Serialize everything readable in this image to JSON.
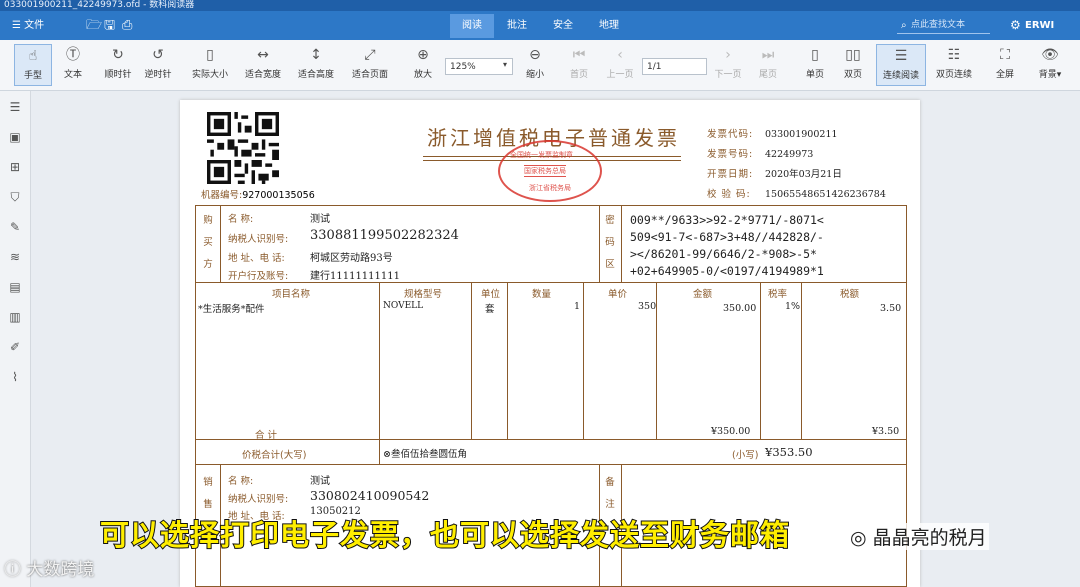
{
  "window": {
    "title": "033001900211_42249973.ofd - 数科阅读器"
  },
  "menubar": {
    "file_label": "☰ 文件",
    "tabs": [
      {
        "label": "阅读"
      },
      {
        "label": "批注"
      },
      {
        "label": "安全"
      },
      {
        "label": "地理"
      }
    ],
    "search_placeholder": "点此查找文本",
    "user_label": "ERWI"
  },
  "toolbar": {
    "tools": [
      "手型",
      "文本",
      "顺时针",
      "逆时针",
      "实际大小",
      "适合宽度",
      "适合高度",
      "适合页面",
      "放大",
      "缩小",
      "首页",
      "上一页",
      "下一页",
      "尾页",
      "单页",
      "双页",
      "连续阅读",
      "双页连续",
      "全屏",
      "背景"
    ],
    "zoom_value": "125%",
    "page_value": "1/1"
  },
  "invoice": {
    "title": "浙江增值税电子普通发票",
    "seal": {
      "line1": "全国统一发票监制章",
      "line2": "国家税务总局",
      "line3": "浙江省税务局"
    },
    "meta": {
      "code_label": "发票代码:",
      "code": "033001900211",
      "number_label": "发票号码:",
      "number": "42249973",
      "date_label": "开票日期:",
      "date": "2020年03月21日",
      "check_label": "校 验 码:",
      "check": "15065548651426236784"
    },
    "machine_label": "机器编号:",
    "machine_no": "927000135056",
    "buyer": {
      "side_label": "购买方",
      "name_label": "名        称:",
      "name": "测试",
      "taxid_label": "纳税人识别号:",
      "taxid": "330881199502282324",
      "addr_label": "地 址、电 话:",
      "addr": "柯城区劳动路93号",
      "bank_label": "开户行及账号:",
      "bank": "建行11111111111"
    },
    "cipher_label": "密码区",
    "cipher": [
      "009**/9633>>92-2*9771/-8071<",
      "509<91-7<-687>3+48//442828/-",
      "></86201-99/6646/2-*908>-5*",
      "+02+649905-0/<0197/4194989*1"
    ],
    "columns": {
      "item": "项目名称",
      "spec": "规格型号",
      "unit": "单位",
      "qty": "数量",
      "price": "单价",
      "amount": "金额",
      "rate": "税率",
      "tax": "税额"
    },
    "rows": [
      {
        "item": "*生活服务*配件",
        "spec": "NOVELL",
        "unit": "套",
        "qty": "1",
        "price": "350",
        "amount": "350.00",
        "rate": "1%",
        "tax": "3.50"
      }
    ],
    "total_label": "合        计",
    "total_amount": "¥350.00",
    "total_tax": "¥3.50",
    "grand_label": "价税合计(大写)",
    "grand_words": "⊗叁佰伍拾叁圆伍角",
    "grand_small_label": "(小写)",
    "grand_small": "¥353.50",
    "seller": {
      "side_label": "销售方",
      "name_label": "名        称:",
      "name": "测试",
      "taxid_label": "纳税人识别号:",
      "taxid": "330802410090542",
      "addr_label": "地 址、电 话:",
      "addr": "13050212"
    },
    "remark_label": "备注"
  },
  "overlay": {
    "caption": "可以选择打印电子发票，也可以选择发送至财务邮箱",
    "watermark_left": "大数跨境",
    "watermark_right": "晶晶亮的税月"
  },
  "colors": {
    "menubar": "#2d78c7",
    "invoice_ink": "#8a5a2b",
    "seal": "#d9362e",
    "caption": "#ffee00"
  }
}
